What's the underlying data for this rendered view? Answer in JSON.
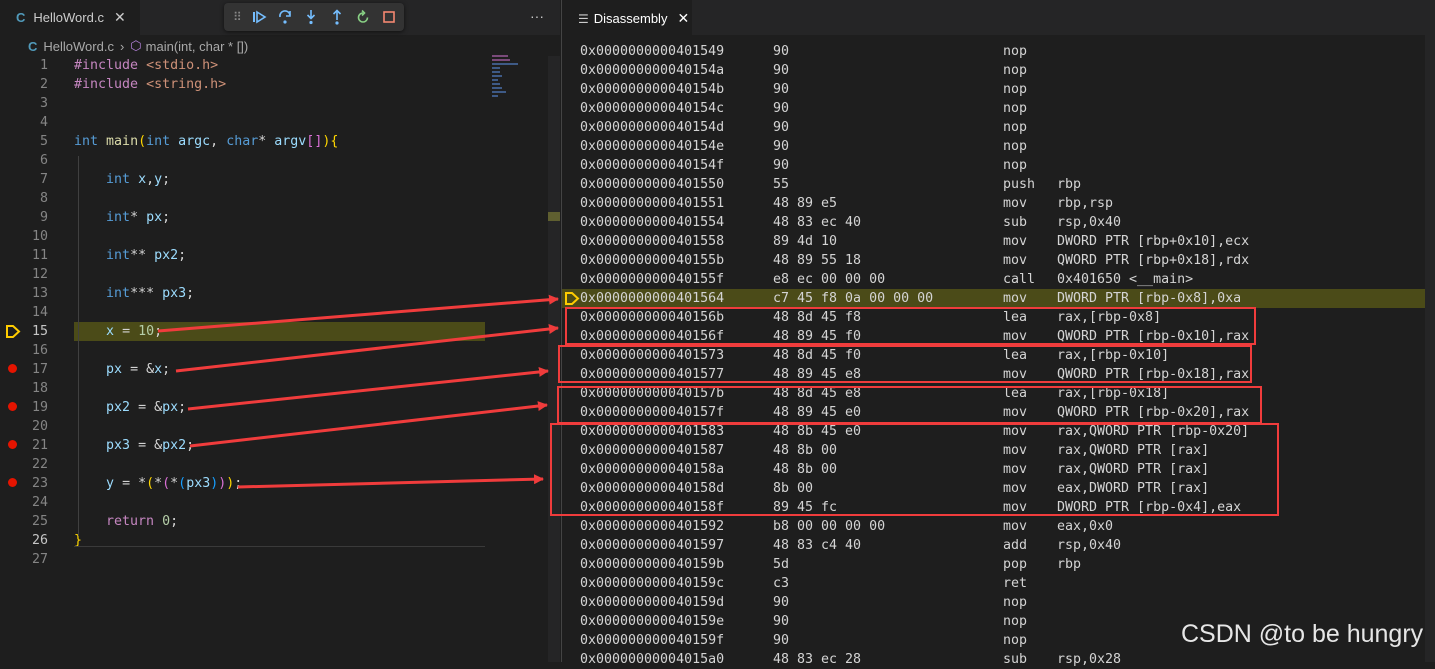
{
  "editor": {
    "tab_icon": "C",
    "tab_label": "HelloWord.c",
    "breadcrumb_file": "HelloWord.c",
    "breadcrumb_symbol": "main(int, char * [])",
    "more_label": "···",
    "debug_toolbar": [
      "continue-icon",
      "step-over-icon",
      "step-into-icon",
      "step-out-icon",
      "restart-icon",
      "stop-icon"
    ],
    "current_line": 15,
    "breakpoints": [
      17,
      19,
      21,
      23
    ],
    "lines": [
      {
        "n": "1",
        "text": "#include <stdio.h>"
      },
      {
        "n": "2",
        "text": "#include <string.h>"
      },
      {
        "n": "3",
        "text": ""
      },
      {
        "n": "4",
        "text": ""
      },
      {
        "n": "5",
        "text": "int main(int argc, char* argv[]){"
      },
      {
        "n": "6",
        "text": ""
      },
      {
        "n": "7",
        "text": "    int x,y;"
      },
      {
        "n": "8",
        "text": ""
      },
      {
        "n": "9",
        "text": "    int* px;"
      },
      {
        "n": "10",
        "text": ""
      },
      {
        "n": "11",
        "text": "    int** px2;"
      },
      {
        "n": "12",
        "text": ""
      },
      {
        "n": "13",
        "text": "    int*** px3;"
      },
      {
        "n": "14",
        "text": ""
      },
      {
        "n": "15",
        "text": "    x = 10;"
      },
      {
        "n": "16",
        "text": ""
      },
      {
        "n": "17",
        "text": "    px = &x;"
      },
      {
        "n": "18",
        "text": ""
      },
      {
        "n": "19",
        "text": "    px2 = &px;"
      },
      {
        "n": "20",
        "text": ""
      },
      {
        "n": "21",
        "text": "    px3 = &px2;"
      },
      {
        "n": "22",
        "text": ""
      },
      {
        "n": "23",
        "text": "    y = *(*(*(px3)));"
      },
      {
        "n": "24",
        "text": ""
      },
      {
        "n": "25",
        "text": "    return 0;"
      },
      {
        "n": "26",
        "text": "}"
      },
      {
        "n": "27",
        "text": ""
      }
    ]
  },
  "disassembly": {
    "tab_label": "Disassembly",
    "rows": [
      {
        "addr": "0x0000000000401549",
        "bytes": "90",
        "op": "nop",
        "arg": ""
      },
      {
        "addr": "0x000000000040154a",
        "bytes": "90",
        "op": "nop",
        "arg": ""
      },
      {
        "addr": "0x000000000040154b",
        "bytes": "90",
        "op": "nop",
        "arg": ""
      },
      {
        "addr": "0x000000000040154c",
        "bytes": "90",
        "op": "nop",
        "arg": ""
      },
      {
        "addr": "0x000000000040154d",
        "bytes": "90",
        "op": "nop",
        "arg": ""
      },
      {
        "addr": "0x000000000040154e",
        "bytes": "90",
        "op": "nop",
        "arg": ""
      },
      {
        "addr": "0x000000000040154f",
        "bytes": "90",
        "op": "nop",
        "arg": ""
      },
      {
        "addr": "0x0000000000401550",
        "bytes": "55",
        "op": "push",
        "arg": "rbp"
      },
      {
        "addr": "0x0000000000401551",
        "bytes": "48 89 e5",
        "op": "mov",
        "arg": "rbp,rsp"
      },
      {
        "addr": "0x0000000000401554",
        "bytes": "48 83 ec 40",
        "op": "sub",
        "arg": "rsp,0x40"
      },
      {
        "addr": "0x0000000000401558",
        "bytes": "89 4d 10",
        "op": "mov",
        "arg": "DWORD PTR [rbp+0x10],ecx"
      },
      {
        "addr": "0x000000000040155b",
        "bytes": "48 89 55 18",
        "op": "mov",
        "arg": "QWORD PTR [rbp+0x18],rdx"
      },
      {
        "addr": "0x000000000040155f",
        "bytes": "e8 ec 00 00 00",
        "op": "call",
        "arg": "0x401650 <__main>"
      },
      {
        "addr": "0x0000000000401564",
        "bytes": "c7 45 f8 0a 00 00 00",
        "op": "mov",
        "arg": "DWORD PTR [rbp-0x8],0xa"
      },
      {
        "addr": "0x000000000040156b",
        "bytes": "48 8d 45 f8",
        "op": "lea",
        "arg": "rax,[rbp-0x8]"
      },
      {
        "addr": "0x000000000040156f",
        "bytes": "48 89 45 f0",
        "op": "mov",
        "arg": "QWORD PTR [rbp-0x10],rax"
      },
      {
        "addr": "0x0000000000401573",
        "bytes": "48 8d 45 f0",
        "op": "lea",
        "arg": "rax,[rbp-0x10]"
      },
      {
        "addr": "0x0000000000401577",
        "bytes": "48 89 45 e8",
        "op": "mov",
        "arg": "QWORD PTR [rbp-0x18],rax"
      },
      {
        "addr": "0x000000000040157b",
        "bytes": "48 8d 45 e8",
        "op": "lea",
        "arg": "rax,[rbp-0x18]"
      },
      {
        "addr": "0x000000000040157f",
        "bytes": "48 89 45 e0",
        "op": "mov",
        "arg": "QWORD PTR [rbp-0x20],rax"
      },
      {
        "addr": "0x0000000000401583",
        "bytes": "48 8b 45 e0",
        "op": "mov",
        "arg": "rax,QWORD PTR [rbp-0x20]"
      },
      {
        "addr": "0x0000000000401587",
        "bytes": "48 8b 00",
        "op": "mov",
        "arg": "rax,QWORD PTR [rax]"
      },
      {
        "addr": "0x000000000040158a",
        "bytes": "48 8b 00",
        "op": "mov",
        "arg": "rax,QWORD PTR [rax]"
      },
      {
        "addr": "0x000000000040158d",
        "bytes": "8b 00",
        "op": "mov",
        "arg": "eax,DWORD PTR [rax]"
      },
      {
        "addr": "0x000000000040158f",
        "bytes": "89 45 fc",
        "op": "mov",
        "arg": "DWORD PTR [rbp-0x4],eax"
      },
      {
        "addr": "0x0000000000401592",
        "bytes": "b8 00 00 00 00",
        "op": "mov",
        "arg": "eax,0x0"
      },
      {
        "addr": "0x0000000000401597",
        "bytes": "48 83 c4 40",
        "op": "add",
        "arg": "rsp,0x40"
      },
      {
        "addr": "0x000000000040159b",
        "bytes": "5d",
        "op": "pop",
        "arg": "rbp"
      },
      {
        "addr": "0x000000000040159c",
        "bytes": "c3",
        "op": "ret",
        "arg": ""
      },
      {
        "addr": "0x000000000040159d",
        "bytes": "90",
        "op": "nop",
        "arg": ""
      },
      {
        "addr": "0x000000000040159e",
        "bytes": "90",
        "op": "nop",
        "arg": ""
      },
      {
        "addr": "0x000000000040159f",
        "bytes": "90",
        "op": "nop",
        "arg": ""
      },
      {
        "addr": "0x00000000004015a0",
        "bytes": "48 83 ec 28",
        "op": "sub",
        "arg": "rsp,0x28"
      }
    ],
    "current_row": 13
  },
  "colors": {
    "current_line": "#4b4b18",
    "breakpoint": "#e51400",
    "annotation": "#f03c3c"
  },
  "watermark": "CSDN @to be hungry"
}
